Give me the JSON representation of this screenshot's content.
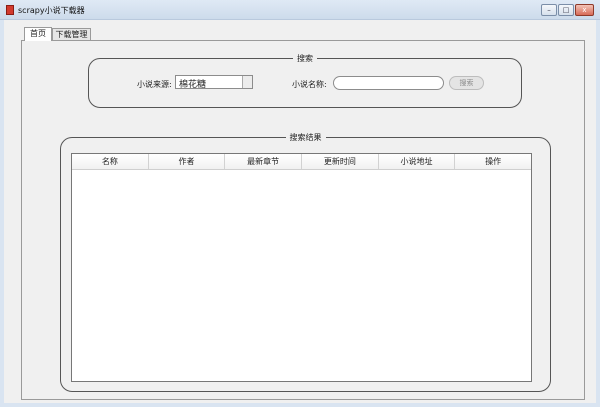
{
  "window": {
    "title": "scrapy小说下载器",
    "minimize": "–",
    "maximize": "□",
    "close": "x"
  },
  "tabs": [
    {
      "label": "首页"
    },
    {
      "label": "下载管理"
    }
  ],
  "search": {
    "legend": "搜索",
    "source_label": "小说来源:",
    "source_value": "棉花糖",
    "name_label": "小说名称:",
    "name_value": "",
    "button_label": "搜索"
  },
  "results": {
    "legend": "搜索结果",
    "columns": [
      {
        "label": "名称"
      },
      {
        "label": "作者"
      },
      {
        "label": "最新章节"
      },
      {
        "label": "更新时间"
      },
      {
        "label": "小说地址"
      },
      {
        "label": "操作"
      }
    ]
  }
}
